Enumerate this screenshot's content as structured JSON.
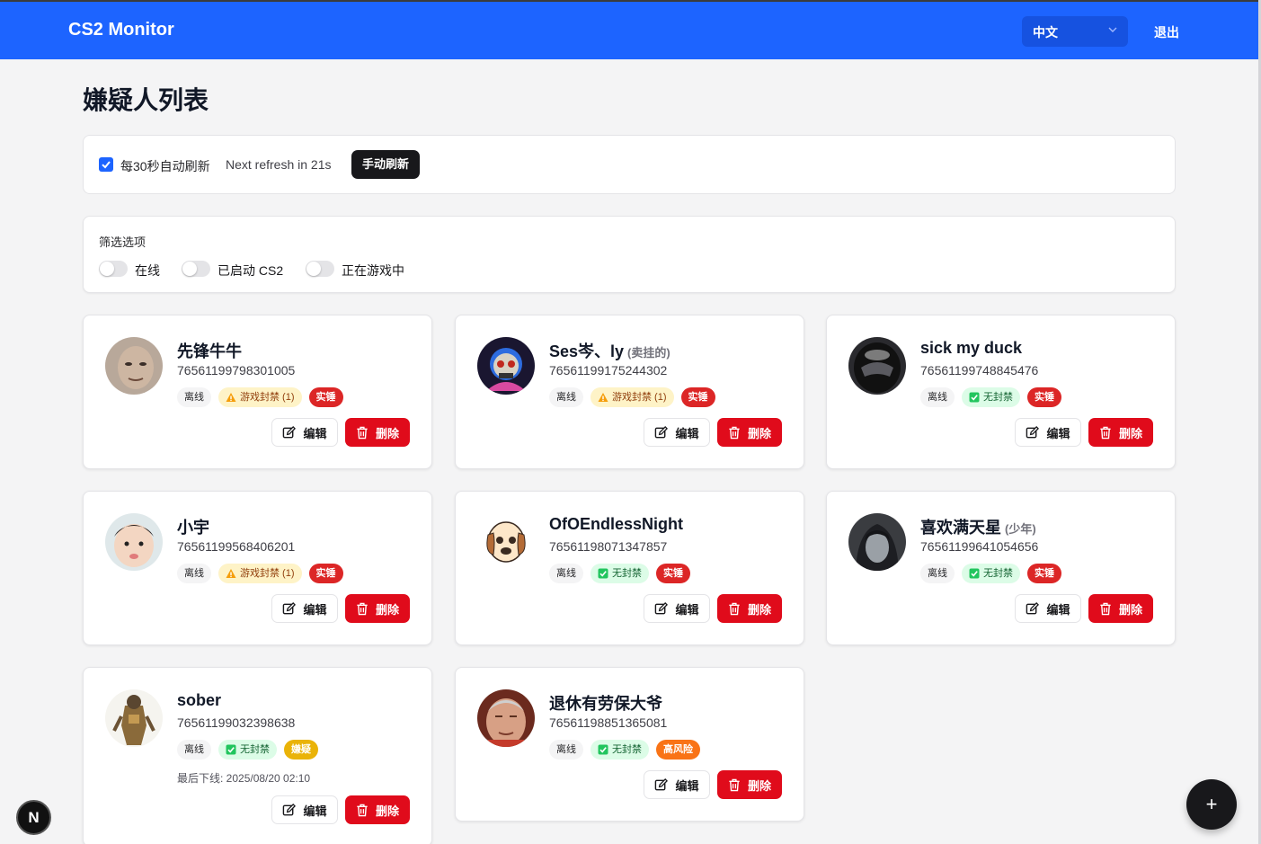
{
  "app": {
    "brand": "CS2 Monitor",
    "language": "中文",
    "logout": "退出"
  },
  "page": {
    "title": "嫌疑人列表"
  },
  "refresh": {
    "auto_label": "每30秒自动刷新",
    "auto_checked": true,
    "next_refresh": "Next refresh in 21s",
    "manual_button": "手动刷新"
  },
  "filters": {
    "title": "筛选选项",
    "options": [
      {
        "label": "在线",
        "enabled": false
      },
      {
        "label": "已启动 CS2",
        "enabled": false
      },
      {
        "label": "正在游戏中",
        "enabled": false
      }
    ]
  },
  "actions": {
    "edit": "编辑",
    "delete": "删除"
  },
  "colors": {
    "primary": "#1d64ff",
    "danger": "#e00b1b",
    "warning_bg": "#fef3c7",
    "success_bg": "#dcfce7",
    "suspect": "#eab308",
    "risk": "#f97316"
  },
  "suspects": [
    {
      "name": "先锋牛牛",
      "alias": "",
      "steam_id": "76561199798301005",
      "status": "离线",
      "ban": "游戏封禁 (1)",
      "ban_icon": "warning-icon",
      "ban_type": "ban",
      "tag": "实锤",
      "tag_type": "confirmed",
      "last_seen": ""
    },
    {
      "name": "Ses岑、ly",
      "alias": "(卖挂的)",
      "steam_id": "76561199175244302",
      "status": "离线",
      "ban": "游戏封禁 (1)",
      "ban_icon": "warning-icon",
      "ban_type": "ban",
      "tag": "实锤",
      "tag_type": "confirmed",
      "last_seen": ""
    },
    {
      "name": "sick my duck",
      "alias": "",
      "steam_id": "76561199748845476",
      "status": "离线",
      "ban": "无封禁",
      "ban_icon": "check-icon",
      "ban_type": "clean",
      "tag": "实锤",
      "tag_type": "confirmed",
      "last_seen": ""
    },
    {
      "name": "小宇",
      "alias": "",
      "steam_id": "76561199568406201",
      "status": "离线",
      "ban": "游戏封禁 (1)",
      "ban_icon": "warning-icon",
      "ban_type": "ban",
      "tag": "实锤",
      "tag_type": "confirmed",
      "last_seen": ""
    },
    {
      "name": "OfOEndlessNight",
      "alias": "",
      "steam_id": "76561198071347857",
      "status": "离线",
      "ban": "无封禁",
      "ban_icon": "check-icon",
      "ban_type": "clean",
      "tag": "实锤",
      "tag_type": "confirmed",
      "last_seen": ""
    },
    {
      "name": "喜欢满天星",
      "alias": "(少年)",
      "steam_id": "76561199641054656",
      "status": "离线",
      "ban": "无封禁",
      "ban_icon": "check-icon",
      "ban_type": "clean",
      "tag": "实锤",
      "tag_type": "confirmed",
      "last_seen": ""
    },
    {
      "name": "sober",
      "alias": "",
      "steam_id": "76561199032398638",
      "status": "离线",
      "ban": "无封禁",
      "ban_icon": "check-icon",
      "ban_type": "clean",
      "tag": "嫌疑",
      "tag_type": "suspect",
      "last_seen": "最后下线: 2025/08/20 02:10"
    },
    {
      "name": "退休有劳保大爷",
      "alias": "",
      "steam_id": "76561198851365081",
      "status": "离线",
      "ban": "无封禁",
      "ban_icon": "check-icon",
      "ban_type": "clean",
      "tag": "高风险",
      "tag_type": "risk",
      "last_seen": ""
    }
  ],
  "fab": "+",
  "dev_badge": "N"
}
